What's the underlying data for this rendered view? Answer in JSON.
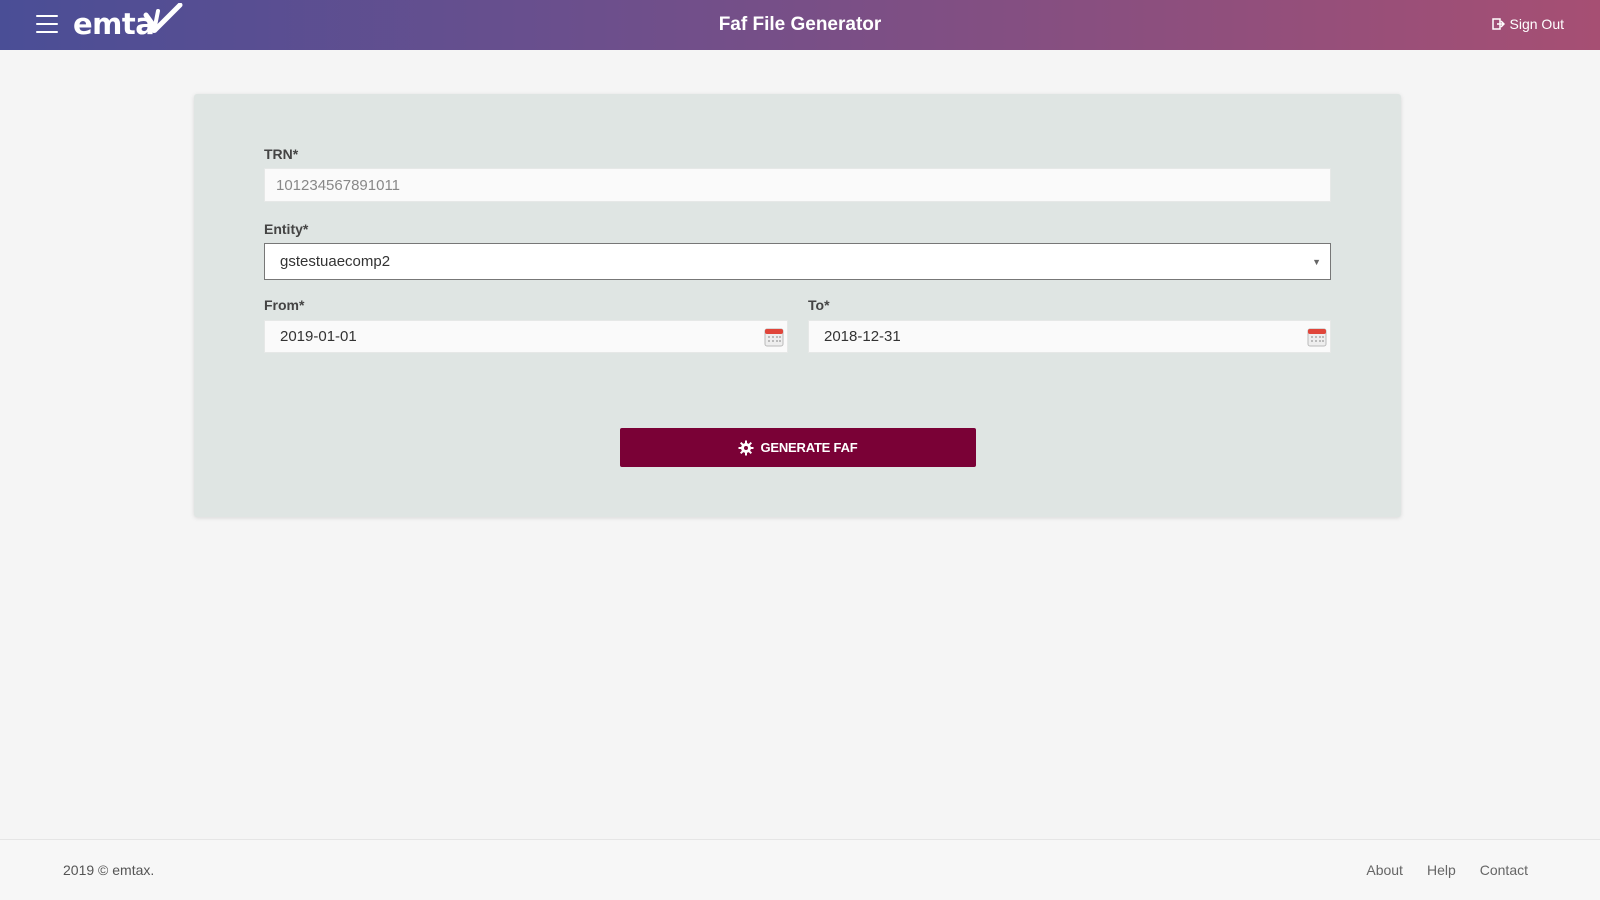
{
  "header": {
    "logo_text": "emta",
    "title": "Faf File Generator",
    "signout_label": "Sign Out",
    "colors": {
      "gradient_start": "#4a4e96",
      "gradient_end": "#a64f73"
    }
  },
  "form": {
    "trn": {
      "label": "TRN*",
      "value": "101234567891011"
    },
    "entity": {
      "label": "Entity*",
      "value": "gstestuaecomp2"
    },
    "from": {
      "label": "From*",
      "value": "2019-01-01"
    },
    "to": {
      "label": "To*",
      "value": "2018-12-31"
    },
    "generate_label": "GENERATE FAF",
    "colors": {
      "button": "#7a0136"
    }
  },
  "footer": {
    "copyright": "2019 © emtax.",
    "links": [
      "About",
      "Help",
      "Contact"
    ]
  },
  "icons": [
    "menu-icon",
    "sign-out-icon",
    "calendar-icon",
    "gear-icon",
    "chevron-down-icon"
  ]
}
